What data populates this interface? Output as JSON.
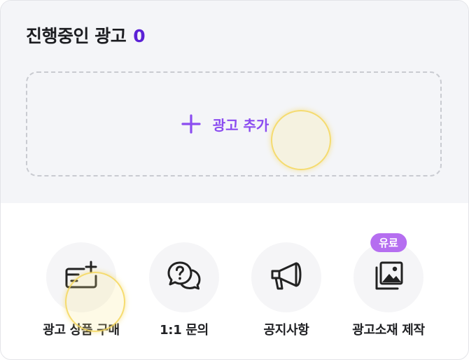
{
  "header": {
    "title": "진행중인 광고",
    "count": "0"
  },
  "add_ad": {
    "label": "광고 추가"
  },
  "menu": [
    {
      "label": "광고 상품 구매",
      "icon": "card-plus-icon"
    },
    {
      "label": "1:1 문의",
      "icon": "chat-question-icon"
    },
    {
      "label": "공지사항",
      "icon": "megaphone-icon"
    },
    {
      "label": "광고소재 제작",
      "icon": "images-icon",
      "badge": "유료"
    }
  ],
  "colors": {
    "accent": "#8b4cf0",
    "count": "#5b21d6",
    "badge": "#b56ef0",
    "top_bg": "#f4f5f8"
  }
}
